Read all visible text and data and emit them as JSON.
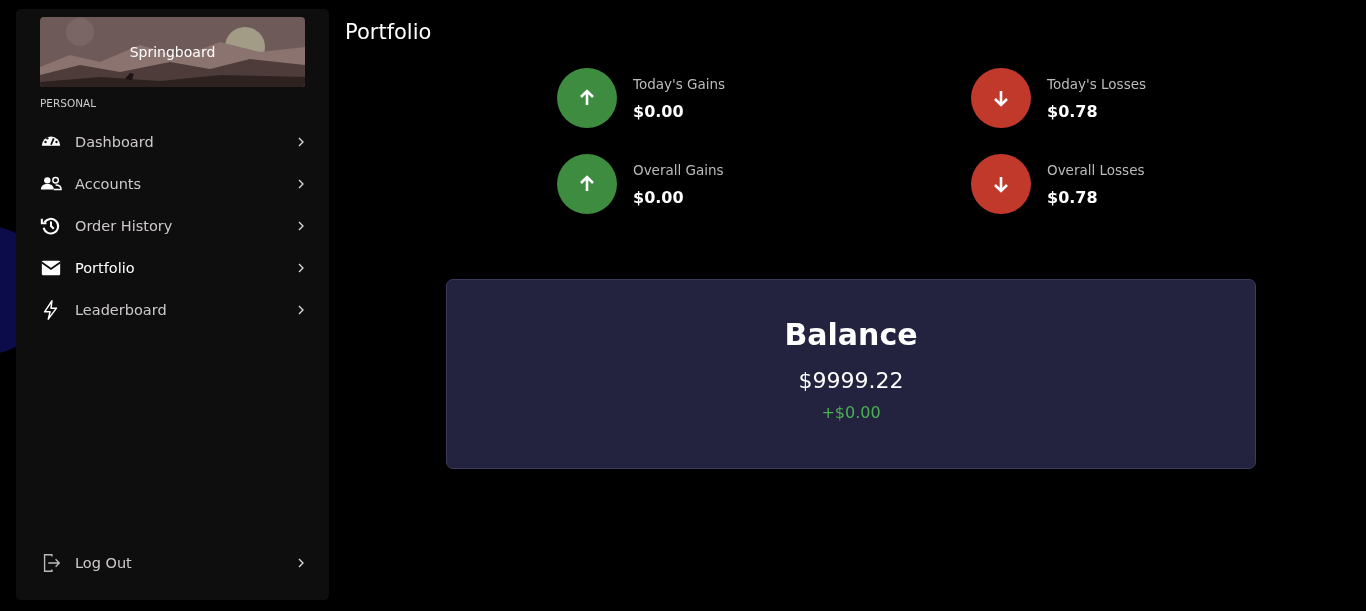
{
  "sidebar": {
    "banner": {
      "title": "Springboard"
    },
    "section": "PERSONAL",
    "items": [
      {
        "label": "Dashboard",
        "selected": false
      },
      {
        "label": "Accounts",
        "selected": false
      },
      {
        "label": "Order History",
        "selected": false
      },
      {
        "label": "Portfolio",
        "selected": true
      },
      {
        "label": "Leaderboard",
        "selected": false
      }
    ],
    "logout": {
      "label": "Log Out"
    }
  },
  "page_title": "Portfolio",
  "stats": [
    {
      "label": "Today's Gains",
      "value": "$0.00",
      "kind": "gain"
    },
    {
      "label": "Today's Losses",
      "value": "$0.78",
      "kind": "loss"
    },
    {
      "label": "Overall Gains",
      "value": "$0.00",
      "kind": "gain"
    },
    {
      "label": "Overall Losses",
      "value": "$0.78",
      "kind": "loss"
    }
  ],
  "balance": {
    "title": "Balance",
    "amount": "$9999.22",
    "change": "+$0.00"
  }
}
